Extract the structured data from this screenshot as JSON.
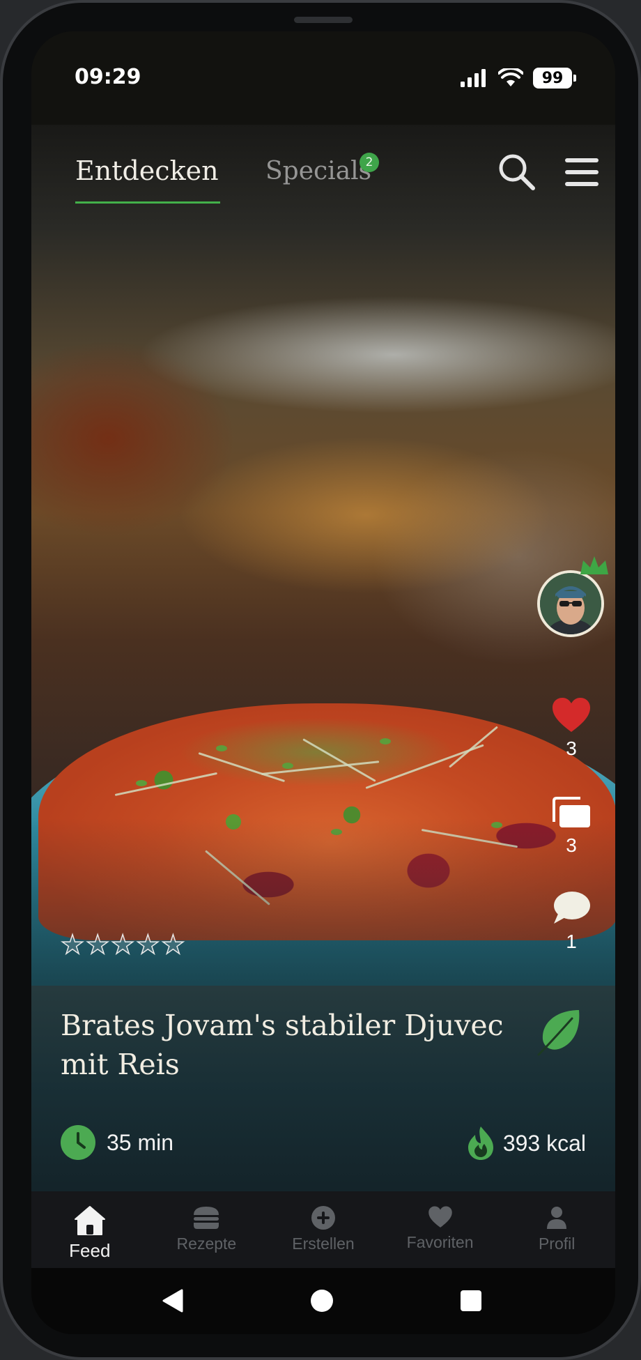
{
  "status_bar": {
    "time": "09:29",
    "battery": "99"
  },
  "top_tabs": [
    {
      "label": "Entdecken",
      "active": true
    },
    {
      "label": "Specials",
      "active": false,
      "badge": "2"
    }
  ],
  "icons": {
    "search": "search-icon",
    "menu": "hamburger-menu-icon",
    "like": "heart-icon",
    "collections": "stacked-cards-icon",
    "comments": "speech-bubble-icon",
    "vegetarian": "leaf-icon",
    "time": "clock-icon",
    "calories": "flame-icon"
  },
  "colors": {
    "accent_green": "#43b04a",
    "heart_red": "#d42a2a",
    "title_cream": "#f1ede2"
  },
  "side_actions": {
    "likes": "3",
    "collections": "3",
    "comments": "1"
  },
  "rating": {
    "stars_filled": 0,
    "stars_total": 5
  },
  "recipe": {
    "title": "Brates Jovam's stabiler Djuvec mit Reis",
    "time": "35 min",
    "calories": "393 kcal"
  },
  "bottom_nav": [
    {
      "label": "Feed",
      "icon": "home-icon",
      "active": true
    },
    {
      "label": "Rezepte",
      "icon": "burger-icon",
      "active": false
    },
    {
      "label": "Erstellen",
      "icon": "plus-circle-icon",
      "active": false
    },
    {
      "label": "Favoriten",
      "icon": "heart-icon",
      "active": false
    },
    {
      "label": "Profil",
      "icon": "person-icon",
      "active": false
    }
  ]
}
